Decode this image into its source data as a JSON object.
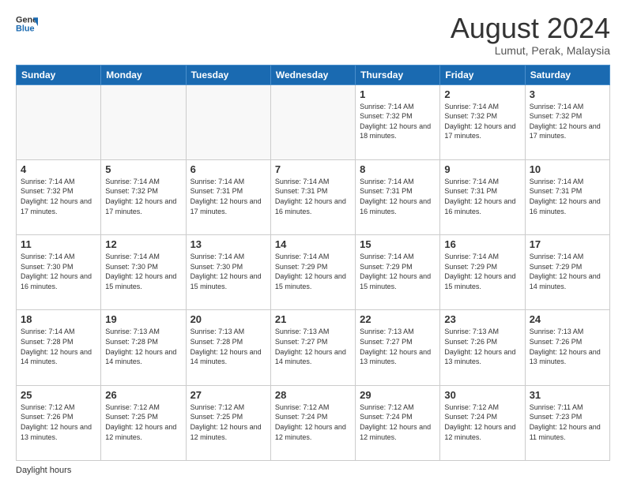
{
  "header": {
    "logo_line1": "General",
    "logo_line2": "Blue",
    "title": "August 2024",
    "subtitle": "Lumut, Perak, Malaysia"
  },
  "days_of_week": [
    "Sunday",
    "Monday",
    "Tuesday",
    "Wednesday",
    "Thursday",
    "Friday",
    "Saturday"
  ],
  "weeks": [
    [
      {
        "day": "",
        "info": ""
      },
      {
        "day": "",
        "info": ""
      },
      {
        "day": "",
        "info": ""
      },
      {
        "day": "",
        "info": ""
      },
      {
        "day": "1",
        "info": "Sunrise: 7:14 AM\nSunset: 7:32 PM\nDaylight: 12 hours and 18 minutes."
      },
      {
        "day": "2",
        "info": "Sunrise: 7:14 AM\nSunset: 7:32 PM\nDaylight: 12 hours and 17 minutes."
      },
      {
        "day": "3",
        "info": "Sunrise: 7:14 AM\nSunset: 7:32 PM\nDaylight: 12 hours and 17 minutes."
      }
    ],
    [
      {
        "day": "4",
        "info": "Sunrise: 7:14 AM\nSunset: 7:32 PM\nDaylight: 12 hours and 17 minutes."
      },
      {
        "day": "5",
        "info": "Sunrise: 7:14 AM\nSunset: 7:32 PM\nDaylight: 12 hours and 17 minutes."
      },
      {
        "day": "6",
        "info": "Sunrise: 7:14 AM\nSunset: 7:31 PM\nDaylight: 12 hours and 17 minutes."
      },
      {
        "day": "7",
        "info": "Sunrise: 7:14 AM\nSunset: 7:31 PM\nDaylight: 12 hours and 16 minutes."
      },
      {
        "day": "8",
        "info": "Sunrise: 7:14 AM\nSunset: 7:31 PM\nDaylight: 12 hours and 16 minutes."
      },
      {
        "day": "9",
        "info": "Sunrise: 7:14 AM\nSunset: 7:31 PM\nDaylight: 12 hours and 16 minutes."
      },
      {
        "day": "10",
        "info": "Sunrise: 7:14 AM\nSunset: 7:31 PM\nDaylight: 12 hours and 16 minutes."
      }
    ],
    [
      {
        "day": "11",
        "info": "Sunrise: 7:14 AM\nSunset: 7:30 PM\nDaylight: 12 hours and 16 minutes."
      },
      {
        "day": "12",
        "info": "Sunrise: 7:14 AM\nSunset: 7:30 PM\nDaylight: 12 hours and 15 minutes."
      },
      {
        "day": "13",
        "info": "Sunrise: 7:14 AM\nSunset: 7:30 PM\nDaylight: 12 hours and 15 minutes."
      },
      {
        "day": "14",
        "info": "Sunrise: 7:14 AM\nSunset: 7:29 PM\nDaylight: 12 hours and 15 minutes."
      },
      {
        "day": "15",
        "info": "Sunrise: 7:14 AM\nSunset: 7:29 PM\nDaylight: 12 hours and 15 minutes."
      },
      {
        "day": "16",
        "info": "Sunrise: 7:14 AM\nSunset: 7:29 PM\nDaylight: 12 hours and 15 minutes."
      },
      {
        "day": "17",
        "info": "Sunrise: 7:14 AM\nSunset: 7:29 PM\nDaylight: 12 hours and 14 minutes."
      }
    ],
    [
      {
        "day": "18",
        "info": "Sunrise: 7:14 AM\nSunset: 7:28 PM\nDaylight: 12 hours and 14 minutes."
      },
      {
        "day": "19",
        "info": "Sunrise: 7:13 AM\nSunset: 7:28 PM\nDaylight: 12 hours and 14 minutes."
      },
      {
        "day": "20",
        "info": "Sunrise: 7:13 AM\nSunset: 7:28 PM\nDaylight: 12 hours and 14 minutes."
      },
      {
        "day": "21",
        "info": "Sunrise: 7:13 AM\nSunset: 7:27 PM\nDaylight: 12 hours and 14 minutes."
      },
      {
        "day": "22",
        "info": "Sunrise: 7:13 AM\nSunset: 7:27 PM\nDaylight: 12 hours and 13 minutes."
      },
      {
        "day": "23",
        "info": "Sunrise: 7:13 AM\nSunset: 7:26 PM\nDaylight: 12 hours and 13 minutes."
      },
      {
        "day": "24",
        "info": "Sunrise: 7:13 AM\nSunset: 7:26 PM\nDaylight: 12 hours and 13 minutes."
      }
    ],
    [
      {
        "day": "25",
        "info": "Sunrise: 7:12 AM\nSunset: 7:26 PM\nDaylight: 12 hours and 13 minutes."
      },
      {
        "day": "26",
        "info": "Sunrise: 7:12 AM\nSunset: 7:25 PM\nDaylight: 12 hours and 12 minutes."
      },
      {
        "day": "27",
        "info": "Sunrise: 7:12 AM\nSunset: 7:25 PM\nDaylight: 12 hours and 12 minutes."
      },
      {
        "day": "28",
        "info": "Sunrise: 7:12 AM\nSunset: 7:24 PM\nDaylight: 12 hours and 12 minutes."
      },
      {
        "day": "29",
        "info": "Sunrise: 7:12 AM\nSunset: 7:24 PM\nDaylight: 12 hours and 12 minutes."
      },
      {
        "day": "30",
        "info": "Sunrise: 7:12 AM\nSunset: 7:24 PM\nDaylight: 12 hours and 12 minutes."
      },
      {
        "day": "31",
        "info": "Sunrise: 7:11 AM\nSunset: 7:23 PM\nDaylight: 12 hours and 11 minutes."
      }
    ]
  ],
  "footer": {
    "label": "Daylight hours"
  }
}
